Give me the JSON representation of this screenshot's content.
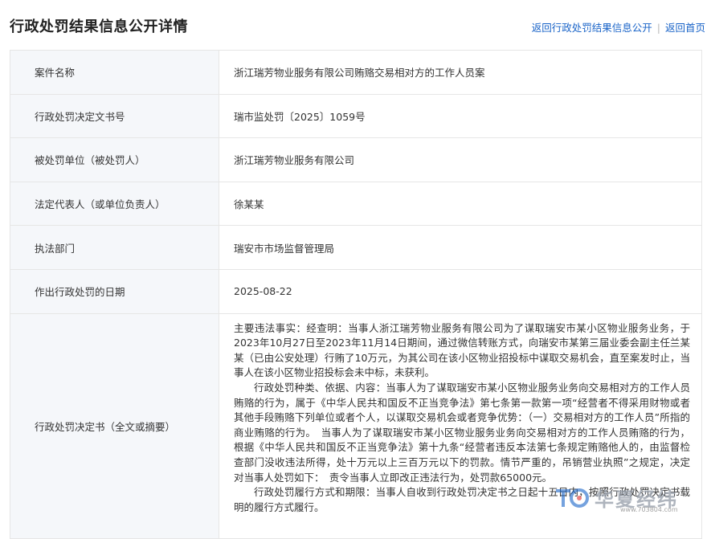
{
  "header": {
    "title": "行政处罚结果信息公开详情",
    "links": [
      "返回行政处罚结果信息公开",
      "返回首页"
    ],
    "separator": "|"
  },
  "rows": [
    {
      "label": "案件名称",
      "value": "浙江瑞芳物业服务有限公司贿赂交易相对方的工作人员案"
    },
    {
      "label": "行政处罚决定文书号",
      "value": "瑞市监处罚〔2025〕1059号"
    },
    {
      "label": "被处罚单位（被处罚人）",
      "value": "浙江瑞芳物业服务有限公司"
    },
    {
      "label": "法定代表人（或单位负责人）",
      "value": "徐某某"
    },
    {
      "label": "执法部门",
      "value": "瑞安市市场监督管理局"
    },
    {
      "label": "作出行政处罚的日期",
      "value": "2025-08-22"
    }
  ],
  "decision": {
    "label": "行政处罚决定书（全文或摘要）",
    "paragraphs": [
      "主要违法事实：经查明：当事人浙江瑞芳物业服务有限公司为了谋取瑞安市某小区物业服务业务，于2023年10月27日至2023年11月14日期间，通过微信转账方式，向瑞安市某第三届业委会副主任兰某某（已由公安处理）行贿了10万元，为其公司在该小区物业招投标中谋取交易机会，直至案发时止，当事人在该小区物业招投标会未中标，未获利。",
      "行政处罚种类、依据、内容：当事人为了谋取瑞安市某小区物业服务业务向交易相对方的工作人员贿赂的行为，属于《中华人民共和国反不正当竞争法》第七条第一款第一项“经营者不得采用财物或者其他手段贿赂下列单位或者个人，以谋取交易机会或者竞争优势：（一）交易相对方的工作人员”所指的商业贿赂的行为。　当事人为了谋取瑞安市某小区物业服务业务向交易相对方的工作人员贿赂的行为，根据《中华人民共和国反不正当竞争法》第十九条“经营者违反本法第七条规定贿赂他人的，由监督检查部门没收违法所得，处十万元以上三百万元以下的罚款。情节严重的，吊销营业执照”之规定，决定对当事人处罚如下：　责令当事人立即改正违法行为，处罚款65000元。",
      "行政处罚履行方式和期限：当事人自收到行政处罚决定书之日起十五日内，按照行政处罚决定书载明的履行方式履行。"
    ]
  },
  "watermark": {
    "text": "华夏经纬",
    "url": "www.703804.com"
  }
}
